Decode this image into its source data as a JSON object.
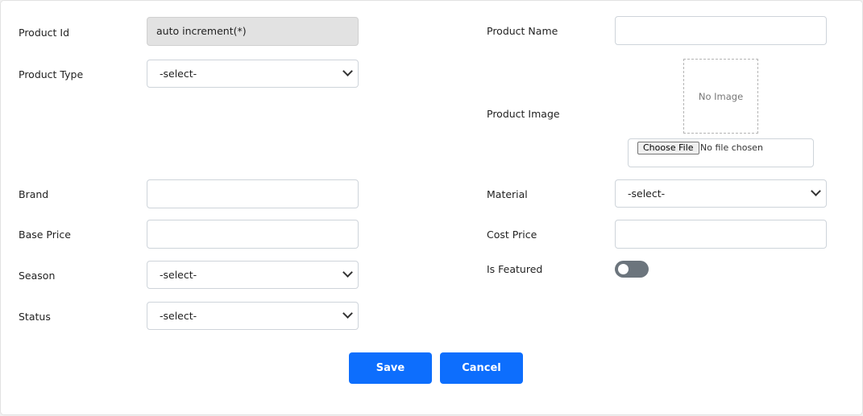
{
  "form": {
    "left": {
      "product_id": {
        "label": "Product Id",
        "value": "auto increment(*)"
      },
      "product_type": {
        "label": "Product Type",
        "value": "-select-"
      },
      "brand": {
        "label": "Brand",
        "value": ""
      },
      "base_price": {
        "label": "Base Price",
        "value": ""
      },
      "season": {
        "label": "Season",
        "value": "-select-"
      },
      "status": {
        "label": "Status",
        "value": "-select-"
      }
    },
    "right": {
      "product_name": {
        "label": "Product Name",
        "value": ""
      },
      "product_image": {
        "label": "Product Image",
        "placeholder_text": "No Image",
        "choose_file_label": "Choose File",
        "file_status": "No file chosen"
      },
      "material": {
        "label": "Material",
        "value": "-select-"
      },
      "cost_price": {
        "label": "Cost Price",
        "value": ""
      },
      "is_featured": {
        "label": "Is Featured",
        "checked": false
      }
    },
    "actions": {
      "save_label": "Save",
      "cancel_label": "Cancel"
    }
  },
  "colors": {
    "primary_button": "#0d6efd",
    "toggle_off": "#6c757d",
    "readonly_field": "#e2e2e2"
  }
}
